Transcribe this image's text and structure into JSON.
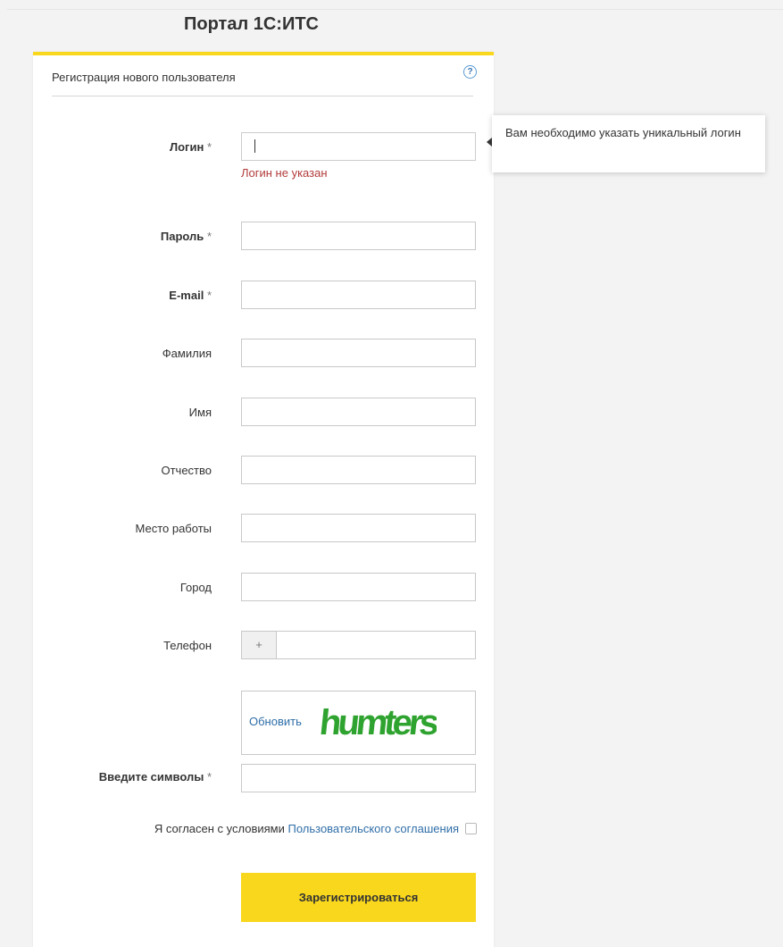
{
  "page": {
    "title": "Портал 1С:ИТС"
  },
  "form": {
    "header": "Регистрация нового пользователя",
    "help_glyph": "?",
    "fields": {
      "login": {
        "label": "Логин",
        "required": "*",
        "value": "",
        "error": "Логин не указан"
      },
      "password": {
        "label": "Пароль",
        "required": "*",
        "value": ""
      },
      "email": {
        "label": "E-mail",
        "required": "*",
        "value": ""
      },
      "lastname": {
        "label": "Фамилия",
        "value": ""
      },
      "firstname": {
        "label": "Имя",
        "value": ""
      },
      "middlename": {
        "label": "Отчество",
        "value": ""
      },
      "workplace": {
        "label": "Место работы",
        "value": ""
      },
      "city": {
        "label": "Город",
        "value": ""
      },
      "phone": {
        "label": "Телефон",
        "prefix": "+",
        "value": ""
      },
      "captcha": {
        "label": "Введите символы",
        "required": "*",
        "value": "",
        "refresh_label": "Обновить",
        "image_text": "humters"
      }
    },
    "agreement": {
      "prefix": "Я согласен с условиями ",
      "link": "Пользовательского соглашения",
      "checked": false
    },
    "submit_label": "Зарегистрироваться"
  },
  "tooltip": {
    "text": "Вам необходимо указать уникальный логин"
  },
  "colors": {
    "accent": "#f9d71c",
    "link": "#2f6ea8",
    "error": "#b23b3b",
    "captcha": "#2fa32f"
  }
}
